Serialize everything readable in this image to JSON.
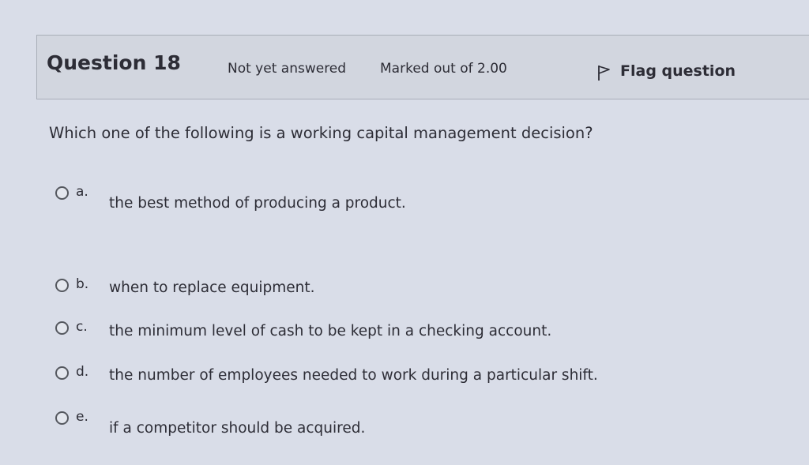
{
  "info": {
    "question_label": "Question 18",
    "state": "Not yet answered",
    "grade": "Marked out of 2.00",
    "flag_label": "Flag question",
    "flag_icon": "flag-icon"
  },
  "question": {
    "text": "Which one of the following is a working capital management decision?"
  },
  "answers": [
    {
      "letter": "a.",
      "text": "the best method of producing a product.",
      "selected": false
    },
    {
      "letter": "b.",
      "text": "when to replace equipment.",
      "selected": false
    },
    {
      "letter": "c.",
      "text": "the minimum level of cash to be kept in a checking account.",
      "selected": false
    },
    {
      "letter": "d.",
      "text": "the number of employees needed to work during a particular shift.",
      "selected": false
    },
    {
      "letter": "e.",
      "text": "if a competitor should be acquired.",
      "selected": false
    }
  ],
  "colors": {
    "background": "#d9dde8",
    "info_box": "#d2d6df",
    "text": "#2d2d36"
  }
}
